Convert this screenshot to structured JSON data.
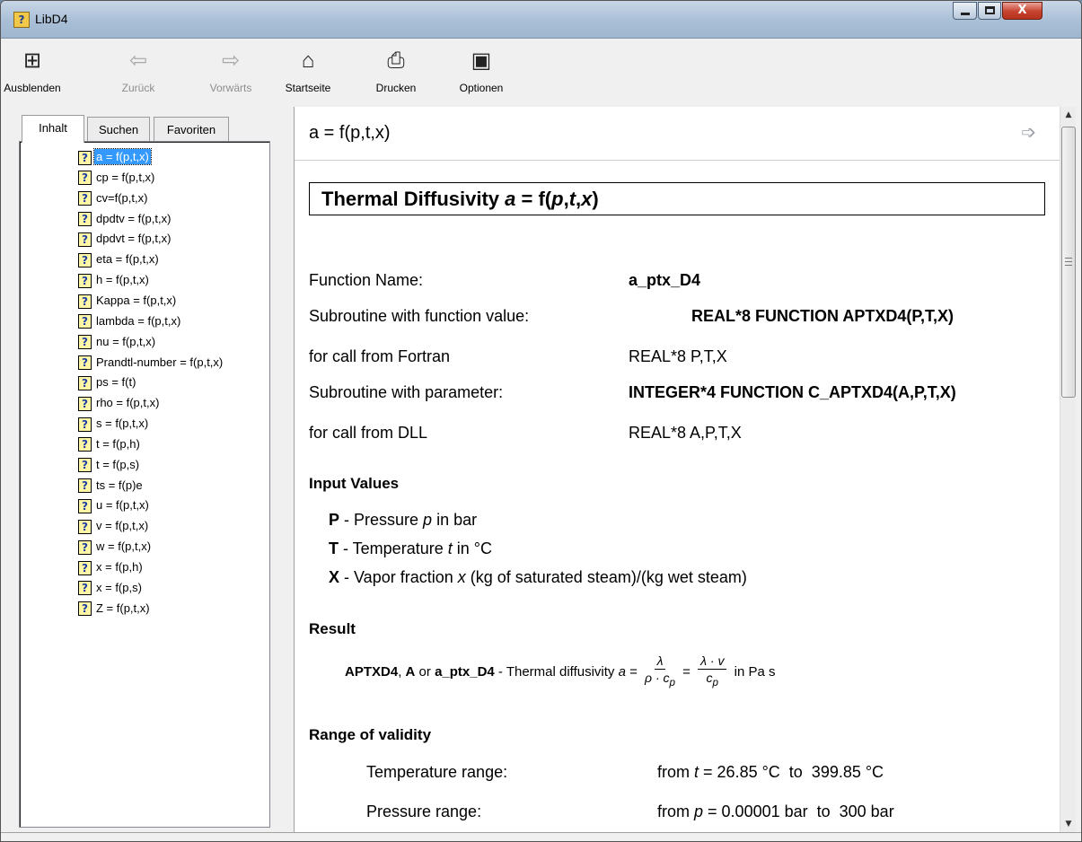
{
  "window": {
    "title": "LibD4",
    "close_glyph": "X"
  },
  "toolbar": {
    "hide_label": "Ausblenden",
    "back_label": "Zurück",
    "forward_label": "Vorwärts",
    "home_label": "Startseite",
    "print_label": "Drucken",
    "options_label": "Optionen"
  },
  "nav": {
    "tabs": [
      "Inhalt",
      "Suchen",
      "Favoriten"
    ],
    "items": [
      "a = f(p,t,x)",
      "cp = f(p,t,x)",
      "cv=f(p,t,x)",
      "dpdtv = f(p,t,x)",
      "dpdvt = f(p,t,x)",
      "eta = f(p,t,x)",
      "h = f(p,t,x)",
      "Kappa = f(p,t,x)",
      "lambda = f(p,t,x)",
      "nu = f(p,t,x)",
      "Prandtl-number = f(p,t,x)",
      "ps = f(t)",
      "rho = f(p,t,x)",
      "s = f(p,t,x)",
      "t = f(p,h)",
      "t = f(p,s)",
      "ts = f(p)e",
      "u = f(p,t,x)",
      "v = f(p,t,x)",
      "w = f(p,t,x)",
      "x = f(p,h)",
      "x = f(p,s)",
      "Z = f(p,t,x)"
    ],
    "selected_index": 0
  },
  "content": {
    "topic_title": "a = f(p,t,x)",
    "heading_prefix": "Thermal Diffusivity ",
    "heading_a": "a",
    "heading_eq": " = f(",
    "heading_p": "p",
    "heading_c1": ",",
    "heading_t": "t",
    "heading_c2": ",",
    "heading_x": "x",
    "heading_close": ")",
    "rows": [
      {
        "label": "Function Name:",
        "value": "a_ptx_D4"
      },
      {
        "label": "Subroutine with function value:",
        "value": "REAL*8 FUNCTION APTXD4(P,T,X)"
      },
      {
        "label": "for call from Fortran",
        "value": "REAL*8 P,T,X"
      },
      {
        "label": "Subroutine with parameter:",
        "value": "INTEGER*4 FUNCTION C_APTXD4(A,P,T,X)"
      },
      {
        "label": "for call from DLL",
        "value": "REAL*8 A,P,T,X"
      }
    ],
    "input_values_heading": "Input Values",
    "inputs": [
      {
        "sym": "P",
        "text": " - Pressure ",
        "var": "p",
        "rest": " in bar"
      },
      {
        "sym": "T",
        "text": " - Temperature ",
        "var": "t",
        "rest": " in °C"
      },
      {
        "sym": "X",
        "text": " - Vapor fraction ",
        "var": "x",
        "rest": " (kg of saturated steam)/(kg wet steam)"
      }
    ],
    "result_heading": "Result",
    "result": {
      "name1": "APTXD4",
      "sep1": ", ",
      "name2": "A",
      "or": " or ",
      "name3": "a_ptx_D4",
      "desc": " - Thermal diffusivity ",
      "var": "a",
      "eq1": " = ",
      "num1": "λ",
      "den1": "ρ · c",
      "den1_sub": "p",
      "eq2": " = ",
      "num2": "λ · v",
      "den2": "c",
      "den2_sub": "p",
      "unit": " in Pa s"
    },
    "range_heading": "Range of validity",
    "ranges": [
      {
        "label": "Temperature range:",
        "from": "from ",
        "var": "t",
        "value": " = 26.85 °C  to  399.85 °C"
      },
      {
        "label": "Pressure range:",
        "from": "from ",
        "var": "p",
        "value": " = 0.00001 bar  to  300 bar"
      }
    ]
  }
}
